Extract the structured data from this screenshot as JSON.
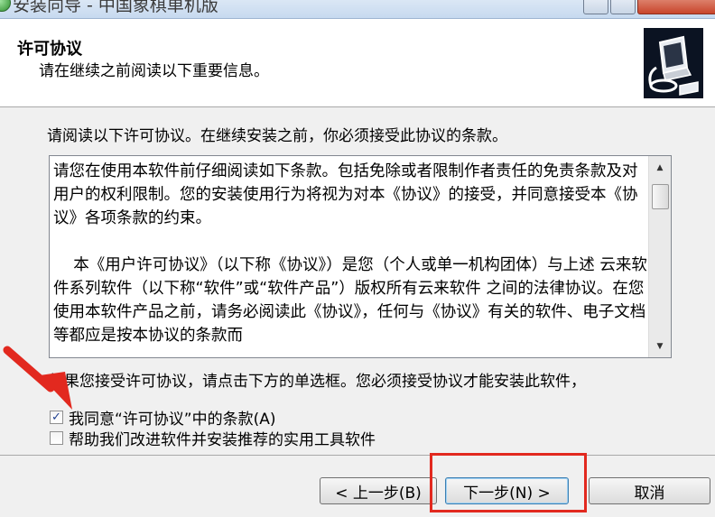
{
  "window": {
    "title": "安装向导 - 中国象棋单机版"
  },
  "header": {
    "title": "许可协议",
    "subtitle": "请在继续之前阅读以下重要信息。"
  },
  "intro_text": "请阅读以下许可协议。在继续安装之前，你必须接受此协议的条款。",
  "license": {
    "text": "请您在使用本软件前仔细阅读如下条款。包括免除或者限制作者责任的免责条款及对用户的权利限制。您的安装使用行为将视为对本《协议》的接受，并同意接受本《协议》各项条款的约束。\n\n    本《用户许可协议》（以下称《协议》）是您（个人或单一机构团体）与上述 云来软件系列软件（以下称“软件”或“软件产品”）版权所有云来软件 之间的法律协议。在您使用本软件产品之前，请务必阅读此《协议》，任何与《协议》有关的软件、电子文档等都应是按本协议的条款而"
  },
  "accept_note": "如果您接受许可协议，请点击下方的单选框。您必须接受协议才能安装此软件，",
  "options": {
    "agree": {
      "label": "我同意“许可协议”中的条款(A)",
      "checked": true
    },
    "improve": {
      "label": "帮助我们改进软件并安装推荐的实用工具软件",
      "checked": false
    }
  },
  "buttons": {
    "back": "< 上一步(B)",
    "next": "下一步(N) >",
    "cancel": "取消"
  },
  "colors": {
    "annotation_red": "#e2291f",
    "header_bg": "#ffffff",
    "dialog_bg": "#f0f0f0"
  }
}
